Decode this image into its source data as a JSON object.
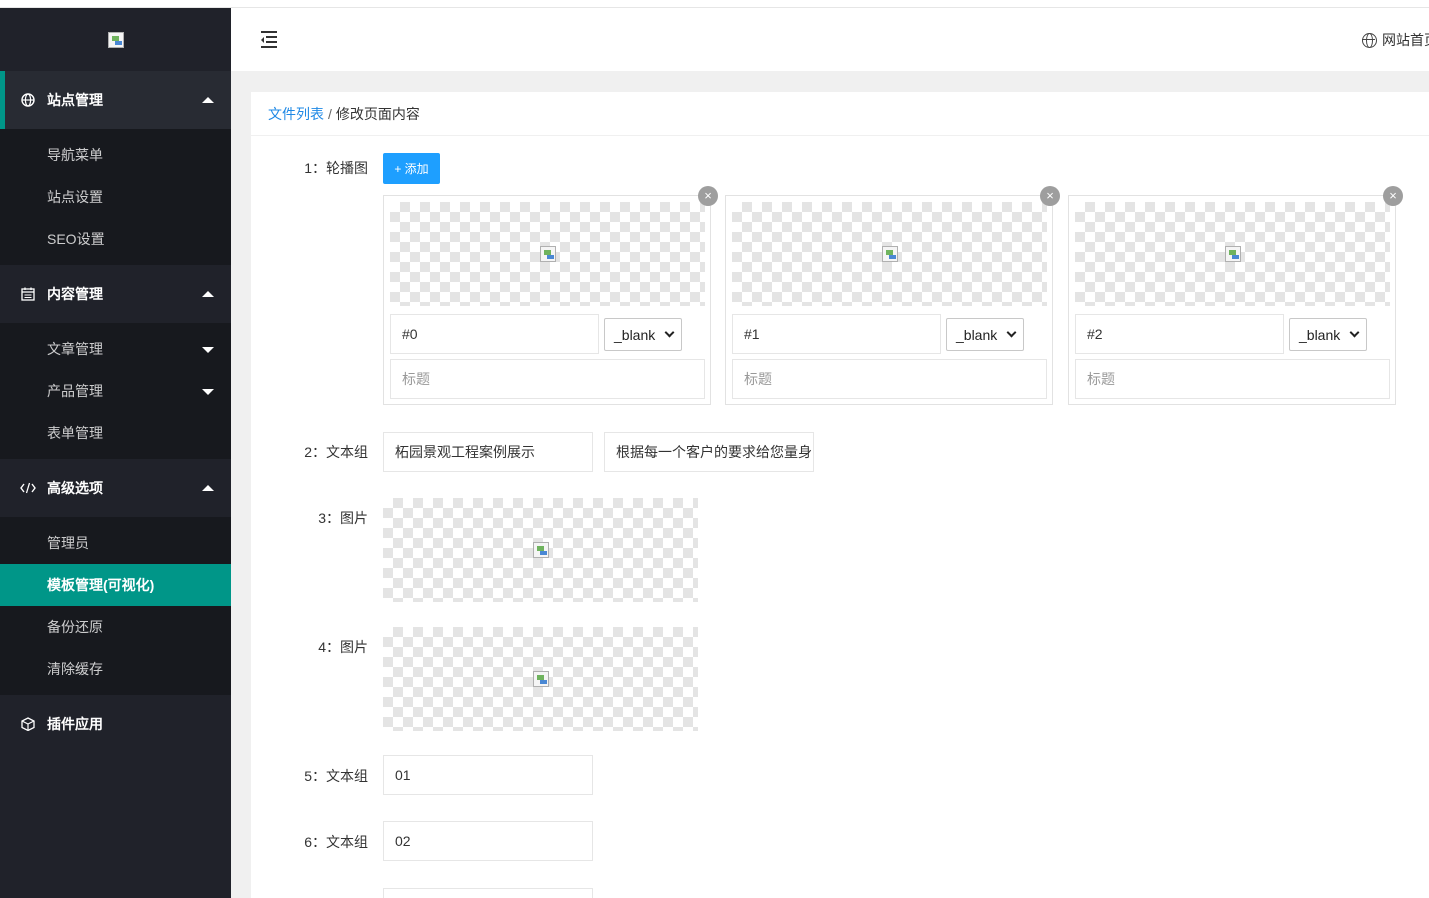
{
  "sidebar": {
    "groups": [
      {
        "label": "站点管理",
        "icon": "globe-icon",
        "items": [
          "导航菜单",
          "站点设置",
          "SEO设置"
        ]
      },
      {
        "label": "内容管理",
        "icon": "calendar-icon",
        "items": [
          "文章管理",
          "产品管理",
          "表单管理"
        ]
      },
      {
        "label": "高级选项",
        "icon": "code-icon",
        "items": [
          "管理员",
          "模板管理(可视化)",
          "备份还原",
          "清除缓存"
        ]
      },
      {
        "label": "插件应用",
        "icon": "cube-icon"
      }
    ],
    "active_item": "模板管理(可视化)"
  },
  "header": {
    "menu_toggle_icon": "menu-fold-icon",
    "site_home_label": "网站首页"
  },
  "breadcrumb": {
    "link": "文件列表",
    "separator": "/",
    "current": "修改页面内容"
  },
  "form": {
    "carousel": {
      "label": "1：轮播图",
      "add_label": "+ 添加",
      "slides": [
        {
          "link": "#0",
          "target": "_blank",
          "title_placeholder": "标题"
        },
        {
          "link": "#1",
          "target": "_blank",
          "title_placeholder": "标题"
        },
        {
          "link": "#2",
          "target": "_blank",
          "title_placeholder": "标题"
        }
      ]
    },
    "text_group_2": {
      "label": "2：文本组",
      "values": [
        "柘园景观工程案例展示",
        "根据每一个客户的要求给您量身"
      ]
    },
    "image_3": {
      "label": "3：图片"
    },
    "image_4": {
      "label": "4：图片"
    },
    "text_group_5": {
      "label": "5：文本组",
      "value": "01"
    },
    "text_group_6": {
      "label": "6：文本组",
      "value": "02"
    }
  },
  "colors": {
    "accent": "#009688",
    "button": "#1e9fff",
    "sidebar": "#20222a"
  }
}
